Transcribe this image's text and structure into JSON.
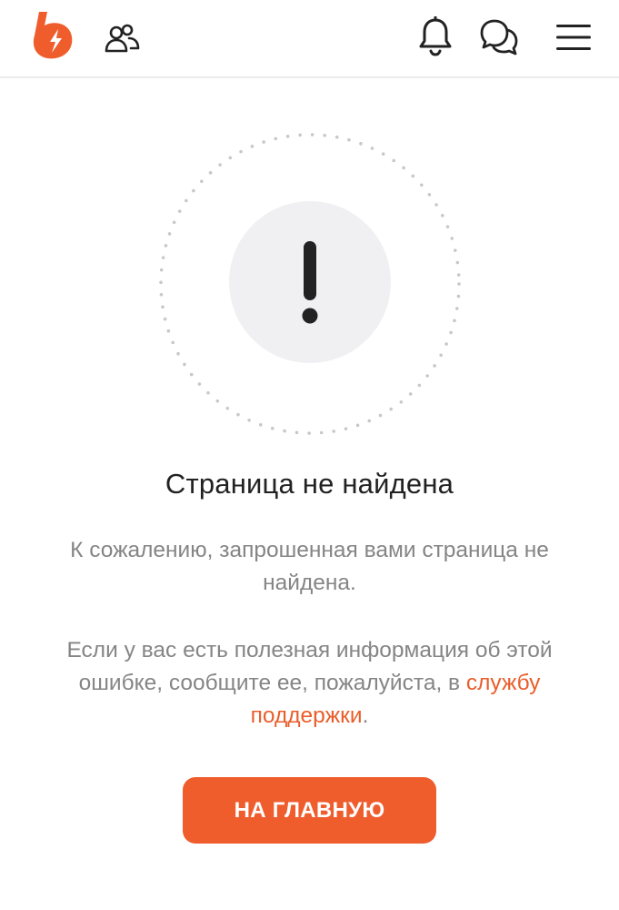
{
  "header": {
    "logo_icon": "lightning-b-logo",
    "friends_icon": "users-icon",
    "notifications_icon": "bell-icon",
    "messages_icon": "chat-bubbles-icon",
    "menu_icon": "hamburger-icon"
  },
  "error": {
    "icon": "exclamation-icon",
    "title": "Страница не найдена",
    "description": "К сожалению, запрошенная вами страница не найдена.",
    "support_before": "Если у вас есть полезная информация об этой ошибке, сообщите ее, пожалуйста, в ",
    "support_link": "службу поддержки",
    "support_after": "."
  },
  "home_button": {
    "label": "НА ГЛАВНУЮ"
  },
  "colors": {
    "accent": "#ef5d2d",
    "link": "#e95e2b",
    "icon_dark": "#222222",
    "muted_text": "#858585",
    "circle_fill": "#f0f0f2",
    "dots": "#c8c8c8"
  }
}
